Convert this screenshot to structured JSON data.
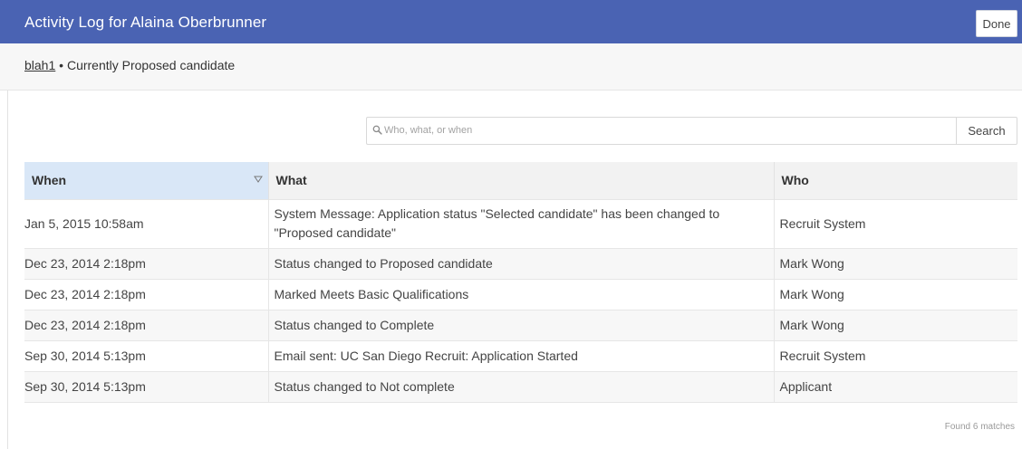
{
  "header": {
    "title": "Activity Log for Alaina Oberbrunner",
    "done_label": "Done"
  },
  "subbar": {
    "link": "blah1",
    "separator": "•",
    "status": "Currently Proposed candidate"
  },
  "search": {
    "placeholder": "Who, what, or when",
    "button_label": "Search"
  },
  "table": {
    "columns": [
      "When",
      "What",
      "Who"
    ],
    "rows": [
      {
        "when": "Jan 5, 2015 10:58am",
        "what": "System Message: Application status \"Selected candidate\" has been changed to \"Proposed candidate\"",
        "who": "Recruit System"
      },
      {
        "when": "Dec 23, 2014 2:18pm",
        "what": "Status changed to Proposed candidate",
        "who": "Mark Wong"
      },
      {
        "when": "Dec 23, 2014 2:18pm",
        "what": "Marked Meets Basic Qualifications",
        "who": "Mark Wong"
      },
      {
        "when": "Dec 23, 2014 2:18pm",
        "what": "Status changed to Complete",
        "who": "Mark Wong"
      },
      {
        "when": "Sep 30, 2014 5:13pm",
        "what": "Email sent: UC San Diego Recruit: Application Started",
        "who": "Recruit System"
      },
      {
        "when": "Sep 30, 2014 5:13pm",
        "what": "Status changed to Not complete",
        "who": "Applicant"
      }
    ]
  },
  "footer": {
    "found_text": "Found 6 matches"
  },
  "icons": {
    "search": "search-icon",
    "sort": "sort-desc-icon"
  },
  "colors": {
    "header_bg": "#4a63b3",
    "sorted_header_bg": "#d9e7f7"
  }
}
